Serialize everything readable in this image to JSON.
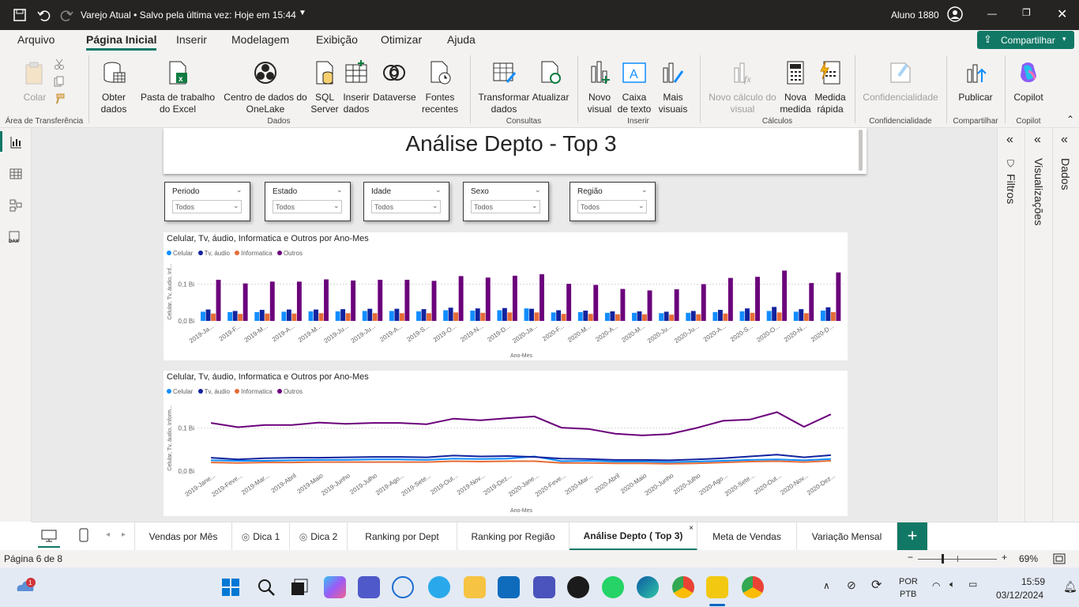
{
  "titlebar": {
    "doc_title": "Varejo Atual • Salvo pela última vez: Hoje em 15:44",
    "user": "Aluno 1880"
  },
  "ribbon": {
    "tabs": [
      "Arquivo",
      "Página Inicial",
      "Inserir",
      "Modelagem",
      "Exibição",
      "Otimizar",
      "Ajuda"
    ],
    "share_label": "Compartilhar",
    "buttons": {
      "colar": "Colar",
      "obter_dados": "Obter dados",
      "pasta_excel": "Pasta de trabalho do Excel",
      "onelake": "Centro de dados do OneLake",
      "sql": "SQL Server",
      "inserir_dados": "Inserir dados",
      "dataverse": "Dataverse",
      "fontes": "Fontes recentes",
      "transformar": "Transformar dados",
      "atualizar": "Atualizar",
      "novo_visual": "Novo visual",
      "caixa_texto": "Caixa de texto",
      "mais_visuais": "Mais visuais",
      "novo_calculo": "Novo cálculo do visual",
      "nova_medida": "Nova medida",
      "medida_rapida": "Medida rápida",
      "confidencialidade": "Confidencialidade",
      "publicar": "Publicar",
      "copilot": "Copilot"
    },
    "groups": {
      "clipboard": "Área de Transferência",
      "dados": "Dados",
      "consultas": "Consultas",
      "inserir": "Inserir",
      "calculos": "Cálculos",
      "confidencialidade": "Confidencialidade",
      "compartilhar": "Compartilhar",
      "copilot": "Copilot"
    }
  },
  "report": {
    "title": "Análise Depto - Top 3",
    "slicers": [
      {
        "label": "Periodo",
        "value": "Todos"
      },
      {
        "label": "Estado",
        "value": "Todos"
      },
      {
        "label": "Idade",
        "value": "Todos"
      },
      {
        "label": "Sexo",
        "value": "Todos"
      },
      {
        "label": "Região",
        "value": "Todos"
      }
    ]
  },
  "panes": {
    "filtros": "Filtros",
    "visualizacoes": "Visualizações",
    "dados": "Dados"
  },
  "page_tabs": [
    "Vendas por Mês",
    "Dica 1",
    "Dica 2",
    "Ranking por Dept",
    "Ranking por Região",
    "Análise Depto ( Top 3)",
    "Meta de Vendas",
    "Variação Mensal"
  ],
  "active_tab": "Análise Depto ( Top 3)",
  "status": {
    "page": "Página 6 de 8",
    "zoom": "69%"
  },
  "taskbar": {
    "lang1": "POR",
    "lang2": "PTB",
    "time": "15:59",
    "date": "03/12/2024"
  },
  "colors": {
    "celular": "#118DFF",
    "tv": "#12239E",
    "informatica": "#E66C37",
    "outros": "#6B007B"
  },
  "chart_data": [
    {
      "type": "bar",
      "title": "Celular, Tv, áudio, Informatica e Outros por Ano-Mes",
      "xlabel": "Ano-Mes",
      "ylabel": "Celular, Tv, áudio, Inf...",
      "y_ticks": [
        "0,0 Bi",
        "0,1 Bi"
      ],
      "categories": [
        "2019-Ja...",
        "2019-F...",
        "2019-M...",
        "2019-A...",
        "2019-M...",
        "2019-Ju...",
        "2019-Ju...",
        "2019-A...",
        "2019-S...",
        "2019-O...",
        "2019-N...",
        "2019-D...",
        "2020-Ja...",
        "2020-F...",
        "2020-M...",
        "2020-A...",
        "2020-M...",
        "2020-Ju...",
        "2020-Ju...",
        "2020-A...",
        "2020-S...",
        "2020-O...",
        "2020-N...",
        "2020-D..."
      ],
      "series": [
        {
          "name": "Celular",
          "values": [
            0.025,
            0.024,
            0.024,
            0.025,
            0.026,
            0.026,
            0.027,
            0.027,
            0.026,
            0.029,
            0.028,
            0.029,
            0.034,
            0.023,
            0.024,
            0.022,
            0.022,
            0.021,
            0.022,
            0.024,
            0.026,
            0.027,
            0.025,
            0.028
          ]
        },
        {
          "name": "Tv, áudio",
          "values": [
            0.031,
            0.027,
            0.03,
            0.031,
            0.031,
            0.032,
            0.033,
            0.033,
            0.032,
            0.036,
            0.034,
            0.035,
            0.033,
            0.029,
            0.028,
            0.026,
            0.026,
            0.025,
            0.027,
            0.03,
            0.034,
            0.038,
            0.032,
            0.037
          ]
        },
        {
          "name": "Informatica",
          "values": [
            0.02,
            0.019,
            0.02,
            0.02,
            0.021,
            0.021,
            0.021,
            0.021,
            0.021,
            0.023,
            0.022,
            0.023,
            0.023,
            0.019,
            0.019,
            0.018,
            0.018,
            0.017,
            0.018,
            0.02,
            0.022,
            0.023,
            0.021,
            0.024
          ]
        },
        {
          "name": "Outros",
          "values": [
            0.112,
            0.102,
            0.107,
            0.107,
            0.113,
            0.11,
            0.112,
            0.112,
            0.109,
            0.122,
            0.118,
            0.123,
            0.127,
            0.101,
            0.098,
            0.087,
            0.083,
            0.086,
            0.1,
            0.117,
            0.12,
            0.137,
            0.103,
            0.132
          ]
        }
      ]
    },
    {
      "type": "line",
      "title": "Celular, Tv, áudio, Informatica e Outros por Ano-Mes",
      "xlabel": "Ano-Mes",
      "ylabel": "Celular, Tv, áudio, Inform...",
      "y_ticks": [
        "0,0 Bi",
        "0,1 Bi"
      ],
      "categories": [
        "2019-Jane...",
        "2019-Feve...",
        "2019-Mar...",
        "2019-Abril",
        "2019-Maio",
        "2019-Junho",
        "2019-Julho",
        "2019-Ago...",
        "2019-Sete...",
        "2019-Out...",
        "2019-Nov...",
        "2019-Dez...",
        "2020-Jane...",
        "2020-Feve...",
        "2020-Mar...",
        "2020-Abril",
        "2020-Maio",
        "2020-Junho",
        "2020-Julho",
        "2020-Ago...",
        "2020-Sete...",
        "2020-Out...",
        "2020-Nov...",
        "2020-Dez..."
      ],
      "series": [
        {
          "name": "Celular",
          "values": [
            0.025,
            0.024,
            0.024,
            0.025,
            0.026,
            0.026,
            0.027,
            0.027,
            0.026,
            0.029,
            0.028,
            0.029,
            0.034,
            0.023,
            0.024,
            0.022,
            0.022,
            0.021,
            0.022,
            0.024,
            0.026,
            0.027,
            0.025,
            0.028
          ]
        },
        {
          "name": "Tv, áudio",
          "values": [
            0.031,
            0.027,
            0.03,
            0.031,
            0.031,
            0.032,
            0.033,
            0.033,
            0.032,
            0.036,
            0.034,
            0.035,
            0.033,
            0.029,
            0.028,
            0.026,
            0.026,
            0.025,
            0.027,
            0.03,
            0.034,
            0.038,
            0.032,
            0.037
          ]
        },
        {
          "name": "Informatica",
          "values": [
            0.02,
            0.019,
            0.02,
            0.02,
            0.021,
            0.021,
            0.021,
            0.021,
            0.021,
            0.023,
            0.022,
            0.023,
            0.023,
            0.019,
            0.019,
            0.018,
            0.018,
            0.017,
            0.018,
            0.02,
            0.022,
            0.023,
            0.021,
            0.024
          ]
        },
        {
          "name": "Outros",
          "values": [
            0.112,
            0.102,
            0.107,
            0.107,
            0.113,
            0.11,
            0.112,
            0.112,
            0.109,
            0.122,
            0.118,
            0.123,
            0.127,
            0.101,
            0.098,
            0.087,
            0.083,
            0.086,
            0.1,
            0.117,
            0.12,
            0.137,
            0.103,
            0.132
          ]
        }
      ]
    }
  ]
}
